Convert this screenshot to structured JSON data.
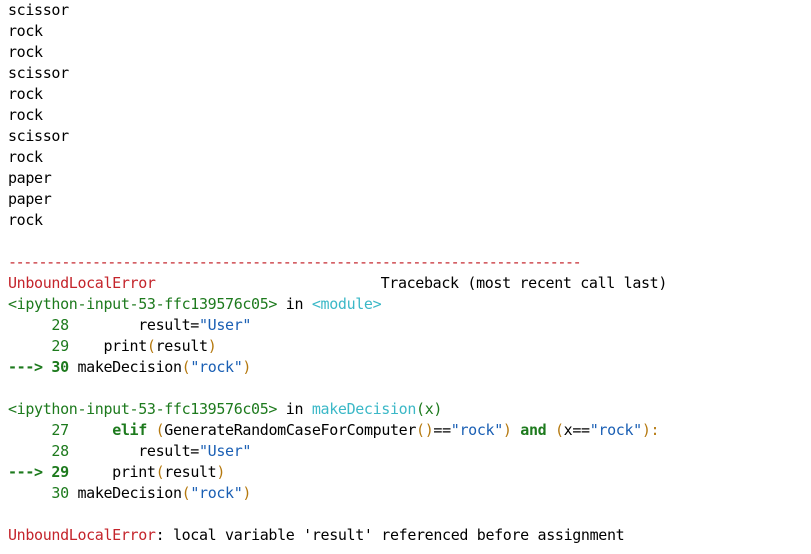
{
  "stdout_lines": [
    "scissor",
    "rock",
    "rock",
    "scissor",
    "rock",
    "rock",
    "scissor",
    "rock",
    "paper",
    "paper",
    "rock"
  ],
  "traceback": {
    "rule": "---------------------------------------------------------------------------",
    "error_name": "UnboundLocalError",
    "header_text": "Traceback (most recent call last)",
    "frame1": {
      "file": "<ipython-input-53-ffc139576c05>",
      "in": " in ",
      "func": "<module>",
      "lines": [
        {
          "marker": "     ",
          "num": "28",
          "code_pre": "        result=",
          "str": "\"User\""
        },
        {
          "marker": "     ",
          "num": "29",
          "code_pre": "    print",
          "open": "(",
          "arg": "result",
          "close": ")"
        },
        {
          "marker": "---> ",
          "num": "30",
          "code_pre": " makeDecision",
          "open": "(",
          "str": "\"rock\"",
          "close": ")"
        }
      ]
    },
    "frame2": {
      "file": "<ipython-input-53-ffc139576c05>",
      "in": " in ",
      "func": "makeDecision",
      "func_args": "(x)",
      "lines": [
        {
          "marker": "     ",
          "num": "27",
          "kw": "elif",
          "p1": " ",
          "open1": "(",
          "fn": "GenerateRandomCaseForComputer",
          "call": "()",
          "eq": "==",
          "str": "\"rock\"",
          "close1": ")",
          "and": " and ",
          "open2": "(",
          "var": "x",
          "eq2": "==",
          "str2": "\"rock\"",
          "close2": "):"
        },
        {
          "marker": "     ",
          "num": "28",
          "code_pre": "        result=",
          "str": "\"User\""
        },
        {
          "marker": "---> ",
          "num": "29",
          "code_pre": "     print",
          "open": "(",
          "arg": "result",
          "close": ")"
        },
        {
          "marker": "     ",
          "num": "30",
          "code_pre": " makeDecision",
          "open": "(",
          "str": "\"rock\"",
          "close": ")"
        }
      ]
    },
    "final_error": {
      "name": "UnboundLocalError",
      "message": ": local variable 'result' referenced before assignment"
    }
  },
  "colors": {
    "error_red": "#c4242b",
    "green": "#1d7a1d",
    "cyan": "#3bb8c7",
    "string_blue": "#1a5fb4",
    "paren_gold": "#b5790f"
  }
}
